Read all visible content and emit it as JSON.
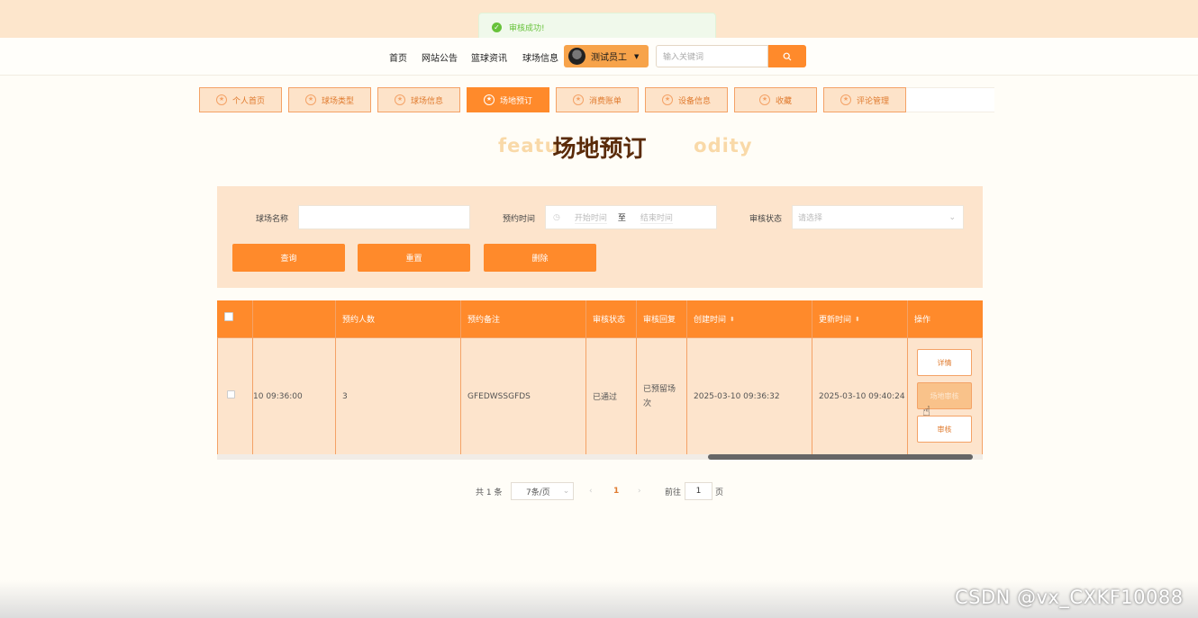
{
  "toast": {
    "icon": "check-circle-icon",
    "text": "审核成功!"
  },
  "nav": {
    "links": [
      "首页",
      "网站公告",
      "篮球资讯",
      "球场信息"
    ],
    "user_name": "测试员工",
    "search_placeholder": "输入关键词"
  },
  "tabs": [
    {
      "label": "个人首页",
      "active": false
    },
    {
      "label": "球场类型",
      "active": false
    },
    {
      "label": "球场信息",
      "active": false
    },
    {
      "label": "场地预订",
      "active": true
    },
    {
      "label": "消费账单",
      "active": false
    },
    {
      "label": "设备信息",
      "active": false
    },
    {
      "label": "收藏",
      "active": false
    },
    {
      "label": "评论管理",
      "active": false
    }
  ],
  "page": {
    "bg_title": "featu                  odity",
    "title": "场地预订"
  },
  "filter": {
    "name_label": "球场名称",
    "time_label": "预约时间",
    "time_start_placeholder": "开始时间",
    "time_sep": "至",
    "time_end_placeholder": "结束时间",
    "status_label": "审核状态",
    "status_placeholder": "请选择",
    "query_btn": "查询",
    "reset_btn": "重置",
    "delete_btn": "删除"
  },
  "table": {
    "headers": [
      "预约人数",
      "预约备注",
      "审核状态",
      "审核回复",
      "创建时间",
      "更新时间",
      "操作"
    ],
    "row": {
      "truncated_time": "10 09:36:00",
      "people": "3",
      "note": "GFEDWSSGFDS",
      "status": "已通过",
      "reply_line1": "已预留场",
      "reply_line2": "次",
      "created": "2025-03-10 09:36:32",
      "updated": "2025-03-10 09:40:24"
    },
    "actions": [
      "详情",
      "场地审核",
      "审核"
    ]
  },
  "pagination": {
    "total": "共 1 条",
    "page_size": "7条/页",
    "current": "1",
    "goto_label": "前往",
    "goto_value": "1",
    "page_suffix": "页"
  },
  "watermark": "CSDN @vx_CXKF10088",
  "colors": {
    "accent": "#ff8a2b",
    "panel": "#fde4cc",
    "success": "#67c23a"
  }
}
